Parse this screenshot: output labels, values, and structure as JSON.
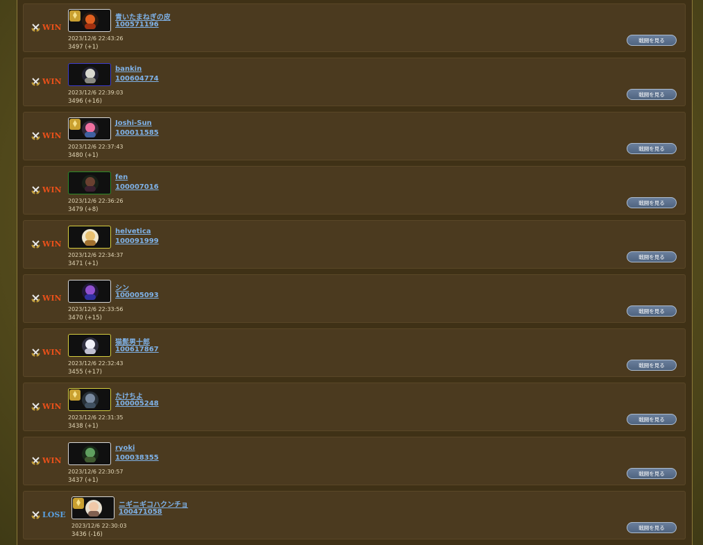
{
  "history": {
    "button_label": "戦闘を見る",
    "colors": {
      "win": "#e8501a",
      "lose": "#5aa0e0",
      "link": "#7fb2e8"
    },
    "entries": [
      {
        "result": "WIN",
        "name": "青いたまねぎの皮",
        "id": "100571196",
        "datetime": "2023/12/6 22:43:26",
        "rating": "3497 (+1)",
        "deck_border": "#d8d8d8",
        "avatar": "orange",
        "badge": true
      },
      {
        "result": "WIN",
        "name": "bankin",
        "id": "100604774",
        "datetime": "2023/12/6 22:39:03",
        "rating": "3496 (+16)",
        "deck_border": "#3b3bd0",
        "avatar": "clock",
        "badge": false
      },
      {
        "result": "WIN",
        "name": "Joshi-Sun",
        "id": "100011585",
        "datetime": "2023/12/6 22:37:43",
        "rating": "3480 (+1)",
        "deck_border": "#d8d8d8",
        "avatar": "pink",
        "badge": true
      },
      {
        "result": "WIN",
        "name": "fen",
        "id": "100007016",
        "datetime": "2023/12/6 22:36:26",
        "rating": "3479 (+8)",
        "deck_border": "#2a8a2a",
        "avatar": "dark",
        "badge": false
      },
      {
        "result": "WIN",
        "name": "helvetica",
        "id": "100091999",
        "datetime": "2023/12/6 22:34:37",
        "rating": "3471 (+1)",
        "deck_border": "#d8d040",
        "avatar": "cream",
        "badge": false
      },
      {
        "result": "WIN",
        "name": "シン",
        "id": "100005093",
        "datetime": "2023/12/6 22:33:56",
        "rating": "3470 (+15)",
        "deck_border": "#d8d8d8",
        "avatar": "purple",
        "badge": false
      },
      {
        "result": "WIN",
        "name": "猫髭男十郎",
        "id": "100617867",
        "datetime": "2023/12/6 22:32:43",
        "rating": "3455 (+17)",
        "deck_border": "#d8d040",
        "avatar": "ghost",
        "badge": false
      },
      {
        "result": "WIN",
        "name": "たけちよ",
        "id": "100005248",
        "datetime": "2023/12/6 22:31:35",
        "rating": "3438 (+1)",
        "deck_border": "#d8d040",
        "avatar": "grey",
        "badge": true
      },
      {
        "result": "WIN",
        "name": "ryoki",
        "id": "100038355",
        "datetime": "2023/12/6 22:30:57",
        "rating": "3437 (+1)",
        "deck_border": "#d8d8d8",
        "avatar": "green",
        "badge": false
      },
      {
        "result": "LOSE",
        "name": "ニギニギコハクンチョ",
        "id": "100471058",
        "datetime": "2023/12/6 22:30:03",
        "rating": "3436 (-16)",
        "deck_border": "#d8d8d8",
        "avatar": "face",
        "badge": true
      }
    ]
  }
}
